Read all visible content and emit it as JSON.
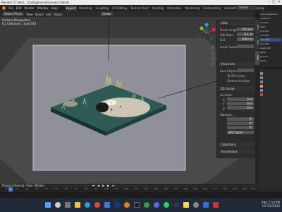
{
  "window": {
    "title": "Blender [C:\\dev\\...\\Cottage\\scene\\project.blend]"
  },
  "menubar": {
    "items": [
      "File",
      "Edit",
      "Render",
      "Window",
      "Help"
    ],
    "workspace_tabs": [
      "Layout",
      "Modeling",
      "Sculpting",
      "UV Editing",
      "Texture Paint",
      "Shading",
      "Animation",
      "Rendering",
      "Compositing",
      "Geometry Nodes",
      "Scripting"
    ],
    "active_tab": "Layout",
    "scene": "Scene"
  },
  "viewport_header": {
    "mode": "Object Mode",
    "menus": [
      "View",
      "Select",
      "Add",
      "Object"
    ],
    "orientation": "Global"
  },
  "viewport": {
    "overlay_line1": "Camera Perspective",
    "overlay_line2": "(1) Collection | rock.013",
    "colors": {
      "background": "#393939",
      "camera_passepartout": "#8e909a",
      "frame": "#c7c8d0",
      "water": "#2f5b55",
      "ground": "#2d5a50"
    }
  },
  "npanel": {
    "view_section": "View",
    "focal_label": "Focal Length",
    "focal_value": "50 mm",
    "clip_start_label": "Clip Start",
    "clip_start_value": "0.1 m",
    "clip_end_label": "End",
    "clip_end_value": "1000 m",
    "local_camera_label": "Local Camera",
    "view_lock_section": "View Lock",
    "lock_object_label": "Lock Object",
    "lock_to_3d_cursor": "To 3D Cursor",
    "lock_camera": "Camera to View",
    "cursor_section": "3D Cursor",
    "location_label": "Location:",
    "x_label": "X",
    "x_value": "0 m",
    "y_label": "Y",
    "y_value": "0 m",
    "z_label": "Z",
    "z_value": "0 m",
    "rotation_label": "Rotation:",
    "rx_value": "0°",
    "ry_value": "0°",
    "rz_value": "0°",
    "rotation_mode": "XYZ Euler",
    "collections_section": "Collections",
    "annotations_section": "Annotations",
    "tabs": [
      "Item",
      "Tool",
      "View"
    ]
  },
  "outliner": {
    "rows": [
      "Scene Collection",
      "Collection",
      "Camera",
      "Light",
      "rock.001",
      "rock.002",
      "rock.013",
      "tree.004",
      "grass.010",
      "water",
      "ground",
      "fence"
    ]
  },
  "timeline": {
    "menus": [
      "Playback",
      "Keying",
      "View",
      "Marker"
    ],
    "current_frame": "1",
    "ticks": [
      "0",
      "10",
      "20",
      "30",
      "40",
      "50",
      "60",
      "70",
      "80",
      "90",
      "100",
      "110",
      "120",
      "130",
      "140",
      "150",
      "160",
      "170",
      "180",
      "190",
      "200",
      "210",
      "220",
      "230",
      "240",
      "250"
    ]
  },
  "taskbar": {
    "tray_lang": "ENG",
    "tray_region": "US",
    "time": "7:14 PM",
    "date": "5/2/2023"
  }
}
